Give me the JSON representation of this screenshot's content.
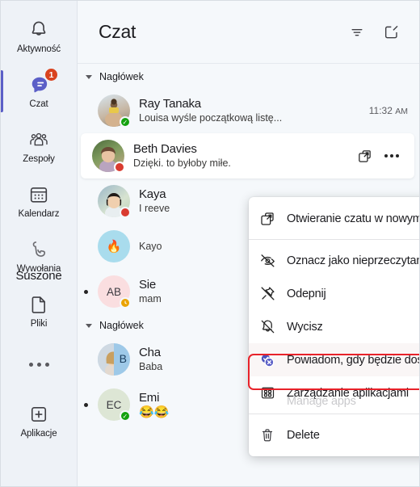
{
  "rail": {
    "items": [
      {
        "label": "Aktywność",
        "icon": "bell-icon",
        "active": false,
        "badge": null
      },
      {
        "label": "Czat",
        "icon": "chat-icon",
        "active": true,
        "badge": "1"
      },
      {
        "label": "Zespoły",
        "icon": "teams-people-icon",
        "active": false,
        "badge": null
      },
      {
        "label": "Kalendarz",
        "icon": "calendar-icon",
        "active": false,
        "badge": null
      },
      {
        "label": "Wywołania",
        "icon": "phone-call-icon",
        "active": false,
        "badge": null
      },
      {
        "label": "Pliki",
        "icon": "file-document-icon",
        "active": false,
        "badge": null
      },
      {
        "label": "",
        "icon": "more-ellipsis-icon",
        "active": false,
        "badge": null
      },
      {
        "label": "Aplikacje",
        "icon": "apps-plus-icon",
        "active": false,
        "badge": null
      }
    ],
    "tooltip_overlay": "Suszone",
    "accent_color": "#5b5fc7",
    "badge_color": "#d9431f",
    "background": "#eef2f7"
  },
  "header": {
    "title": "Czat",
    "filter_icon": "filter-icon",
    "compose_icon": "compose-new-chat-icon"
  },
  "chat_list": {
    "groups": [
      {
        "label": "Nagłówek",
        "rows": [
          {
            "name": "Ray Tanaka",
            "preview": "Louisa wyśle początkową listę...",
            "time": "11:32",
            "time_ampm": "AM",
            "presence": "available",
            "unread": false,
            "selected": false,
            "avatar_type": "photo",
            "avatar_initials": "",
            "avatar_color": "#b9cbd8"
          },
          {
            "name": "Beth Davies",
            "preview": "Dzięki. to byłoby miłe.",
            "time": "",
            "time_ampm": "",
            "presence": "busy",
            "unread": false,
            "selected": true,
            "avatar_type": "photo",
            "avatar_initials": "",
            "avatar_color": "#5d6f4a"
          },
          {
            "name": "Kaya",
            "preview": "I reeve",
            "time": "",
            "time_ampm": "",
            "presence": "busy",
            "unread": false,
            "selected": false,
            "avatar_type": "photo",
            "avatar_initials": "",
            "avatar_color": "#9fb8c9"
          },
          {
            "name": "",
            "preview": "Kayo",
            "time": "",
            "time_ampm": "",
            "presence": "none",
            "unread": false,
            "selected": false,
            "avatar_type": "emoji",
            "avatar_initials": "🔥",
            "avatar_color": "#a9dced"
          },
          {
            "name": "Sie",
            "preview": "mam",
            "time": "",
            "time_ampm": "",
            "presence": "away",
            "unread": true,
            "selected": false,
            "avatar_type": "initials",
            "avatar_initials": "AB",
            "avatar_color": "#fadee0"
          }
        ]
      },
      {
        "label": "Nagłówek",
        "rows": [
          {
            "name": "Cha",
            "preview": "Baba",
            "time": "",
            "time_ampm": "",
            "presence": "none",
            "unread": false,
            "selected": false,
            "avatar_type": "group",
            "avatar_initials": "B",
            "avatar_color": "#9ec9e8"
          },
          {
            "name": "Emi",
            "preview": "😂😂",
            "time": "",
            "time_ampm": "",
            "presence": "available",
            "unread": true,
            "selected": false,
            "avatar_type": "initials",
            "avatar_initials": "EC",
            "avatar_color": "#dde6d5"
          }
        ]
      }
    ],
    "row_actions": {
      "popout_icon": "open-in-new-window-icon",
      "more_icon": "more-options-icon"
    }
  },
  "context_menu": {
    "items": [
      {
        "label": "Otwieranie czatu w nowym oknie",
        "icon": "open-in-new-window-icon",
        "highlighted": false,
        "separator_after": true,
        "ghost": ""
      },
      {
        "label": "Oznacz jako nieprzeczytane",
        "icon": "mark-unread-icon",
        "highlighted": false,
        "separator_after": false,
        "ghost": ""
      },
      {
        "label": "Odepnij",
        "icon": "unpin-icon",
        "highlighted": false,
        "separator_after": false,
        "ghost": ""
      },
      {
        "label": "Wycisz",
        "icon": "mute-bell-icon",
        "highlighted": false,
        "separator_after": false,
        "ghost": ""
      },
      {
        "label": "Powiadom, gdy będzie dostępne",
        "icon": "notify-when-available-icon",
        "highlighted": true,
        "separator_after": false,
        "ghost": ""
      },
      {
        "label": "Zarządzanie aplikacjami",
        "icon": "manage-apps-grid-icon",
        "highlighted": false,
        "separator_after": true,
        "ghost": "Manage apps"
      },
      {
        "label": "Delete",
        "icon": "trash-delete-icon",
        "highlighted": false,
        "separator_after": false,
        "ghost": ""
      }
    ],
    "highlight_color": "#e8222a"
  }
}
